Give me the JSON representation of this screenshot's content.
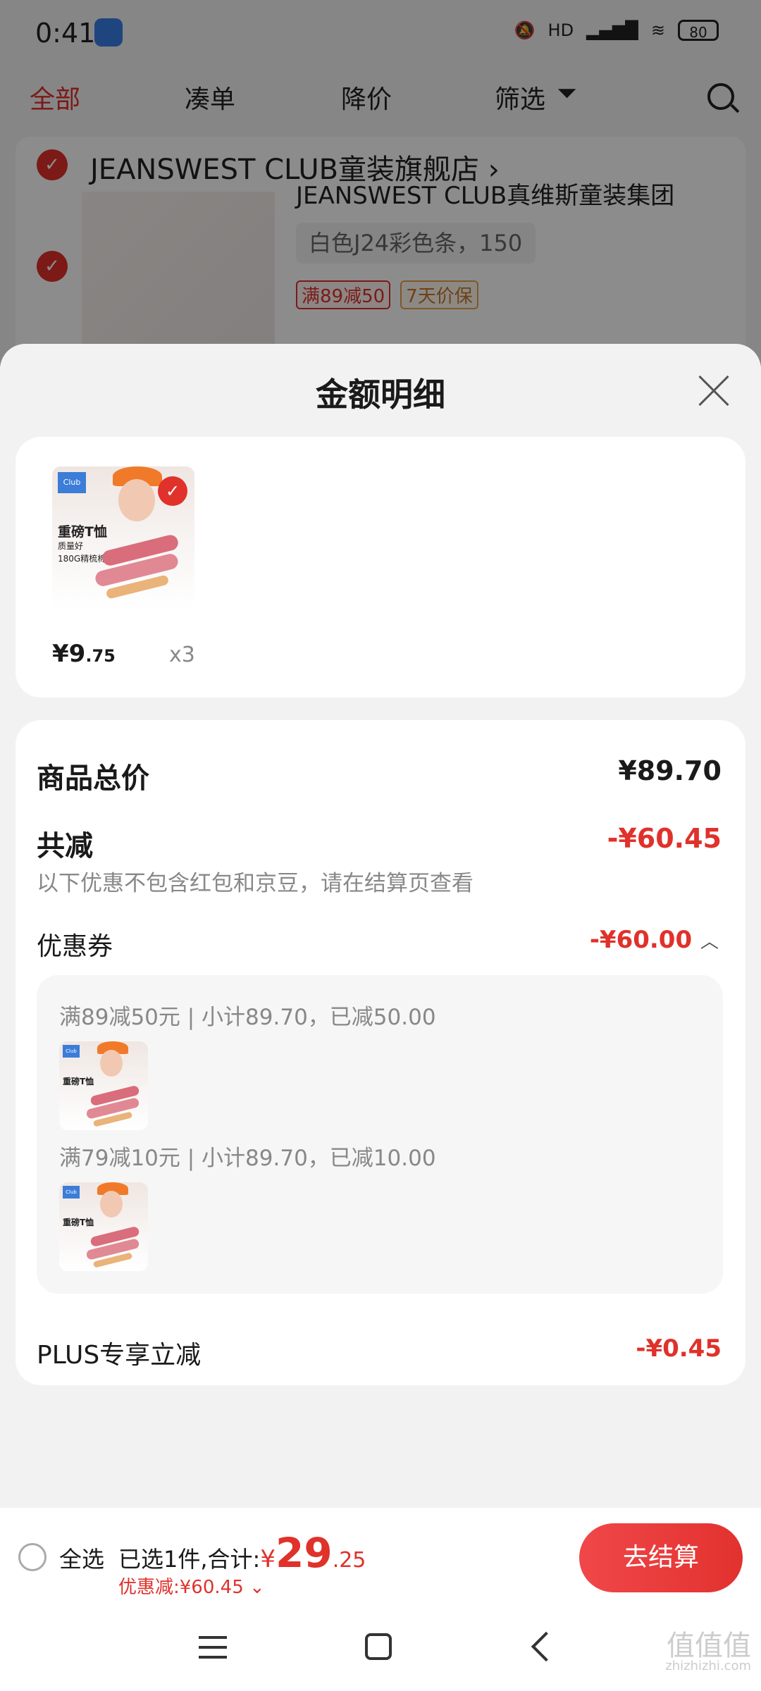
{
  "status_bar": {
    "time": "0:41",
    "battery": "80",
    "network": "HD"
  },
  "cart_tabs": [
    "全部",
    "凑单",
    "降价",
    "筛选"
  ],
  "store": {
    "name": "JEANSWEST CLUB童装旗舰店 ›",
    "product_title": "JEANSWEST CLUB真维斯童装集团",
    "spec": "白色J24彩色条，150 ⌄",
    "tags": [
      "满89减50",
      "7天价保"
    ]
  },
  "product_image_text": {
    "title": "重磅T恤",
    "line1": "质量好",
    "line2": "180G精梳棉"
  },
  "sheet": {
    "title": "金额明细",
    "item": {
      "price_int": "¥9",
      "price_dec": ".75",
      "qty": "x3"
    },
    "total_label": "商品总价",
    "total_value": "¥89.70",
    "reduce_label": "共减",
    "reduce_value": "-¥60.45",
    "reduce_note": "以下优惠不包含红包和京豆，请在结算页查看",
    "coupon_label": "优惠券",
    "coupon_value": "-¥60.00",
    "coupon_lines": [
      "满89减50元 | 小计89.70，已减50.00",
      "满79减10元 | 小计89.70，已减10.00"
    ],
    "plus_label": "PLUS专享立减",
    "plus_value": "-¥0.45"
  },
  "bottom": {
    "select_all": "全选",
    "summary_prefix": "已选1件,合计:",
    "currency": "¥",
    "total_int": "29",
    "total_dec": ".25",
    "discount": "优惠减:¥60.45 ⌄",
    "checkout": "去结算"
  },
  "watermark": {
    "main": "值值值",
    "sub": "zhizhizhi.com"
  },
  "colors": {
    "accent": "#e0312b",
    "background": "#f2f2f2"
  }
}
